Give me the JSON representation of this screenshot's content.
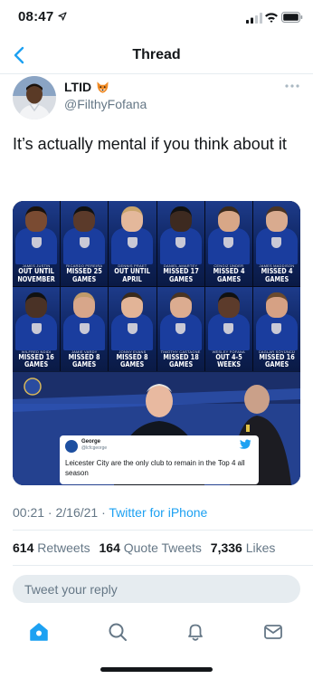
{
  "status_bar": {
    "time": "08:47"
  },
  "nav": {
    "title": "Thread"
  },
  "tweet": {
    "display_name": "LTID",
    "handle": "@FilthyFofana",
    "text": "It’s actually mental if you think about it",
    "timestamp": "00:21 · 2/16/21 · ",
    "source": "Twitter for iPhone"
  },
  "media": {
    "players": [
      {
        "name": "JAMES JUSTIN",
        "status": "OUT UNTIL NOVEMBER"
      },
      {
        "name": "RICARDO PEREIRA",
        "status": "MISSED 25 GAMES"
      },
      {
        "name": "DENNIS PRAET",
        "status": "OUT UNTIL APRIL"
      },
      {
        "name": "DANIEL AMARTEY",
        "status": "MISSED 17 GAMES"
      },
      {
        "name": "CENGIZ ÜNDER",
        "status": "MISSED 4 GAMES"
      },
      {
        "name": "JAMES MADDISON",
        "status": "MISSED 4 GAMES"
      },
      {
        "name": "WILFRED NDIDI",
        "status": "MISSED 16 GAMES"
      },
      {
        "name": "JAMIE VARDY",
        "status": "MISSED 8 GAMES"
      },
      {
        "name": "JONNY EVANS",
        "status": "MISSED 8 GAMES"
      },
      {
        "name": "TIMOTHY CASTAGNE",
        "status": "MISSED 18 GAMES"
      },
      {
        "name": "WESLEY FOFANA",
        "status": "OUT 4-5 WEEKS"
      },
      {
        "name": "CAGLAR SÖYÜNCÜ",
        "status": "MISSED 16 GAMES"
      }
    ],
    "embedded_tweet": {
      "name": "George",
      "handle": "@lcfcgeorge",
      "text": "Leicester City are the only club to remain in the Top 4 all season"
    }
  },
  "stats": {
    "retweets_count": "614",
    "retweets_label": "Retweets",
    "quotes_count": "164",
    "quotes_label": "Quote Tweets",
    "likes_count": "7,336",
    "likes_label": "Likes"
  },
  "reply": {
    "placeholder": "Tweet your reply"
  },
  "colors": {
    "accent": "#1da1f2",
    "secondary_text": "#657786",
    "divider": "#e6ecf0"
  },
  "icons": [
    "location-arrow-icon",
    "signal-icon",
    "wifi-icon",
    "battery-icon",
    "back-chevron-icon",
    "fox-emoji-icon",
    "more-dots-icon",
    "twitter-bird-icon",
    "home-icon",
    "search-icon",
    "notifications-bell-icon",
    "messages-envelope-icon"
  ]
}
